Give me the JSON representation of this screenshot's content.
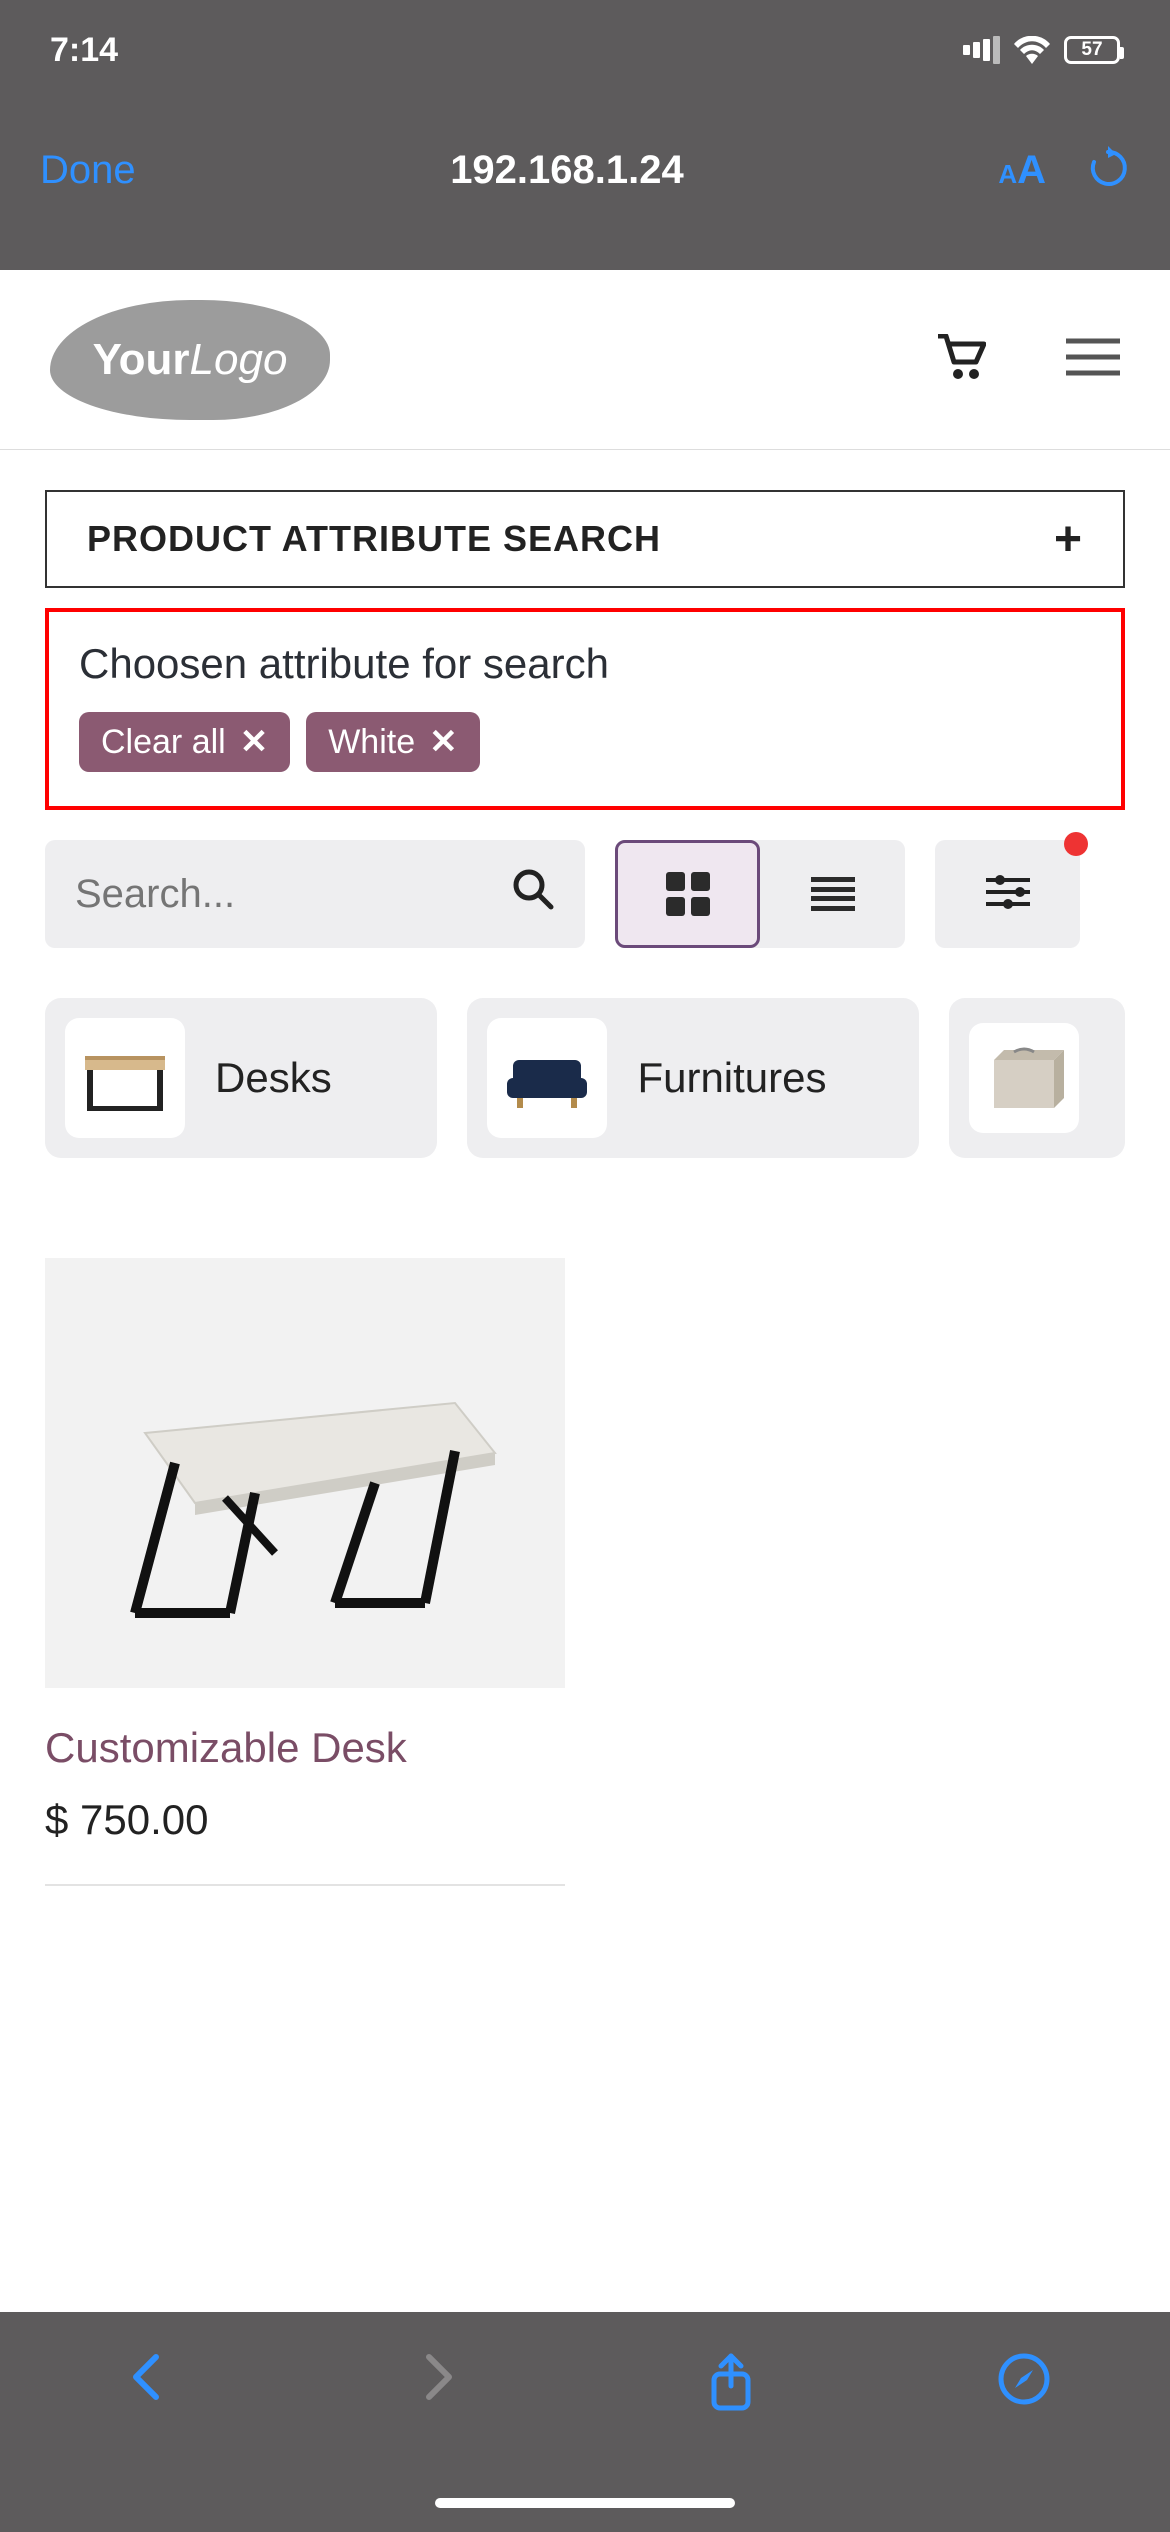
{
  "statusbar": {
    "time": "7:14",
    "battery": "57"
  },
  "browser": {
    "done": "Done",
    "url": "192.168.1.24"
  },
  "header": {
    "logo_your": "Your",
    "logo_logo": "Logo"
  },
  "attr_search": {
    "label": "PRODUCT ATTRIBUTE SEARCH"
  },
  "chosen": {
    "title": "Choosen attribute for search",
    "chips": [
      {
        "label": "Clear all"
      },
      {
        "label": "White"
      }
    ]
  },
  "search": {
    "placeholder": "Search..."
  },
  "categories": [
    {
      "label": "Desks"
    },
    {
      "label": "Furnitures"
    },
    {
      "label": ""
    }
  ],
  "product": {
    "title": "Customizable Desk",
    "price": "$ 750.00"
  }
}
